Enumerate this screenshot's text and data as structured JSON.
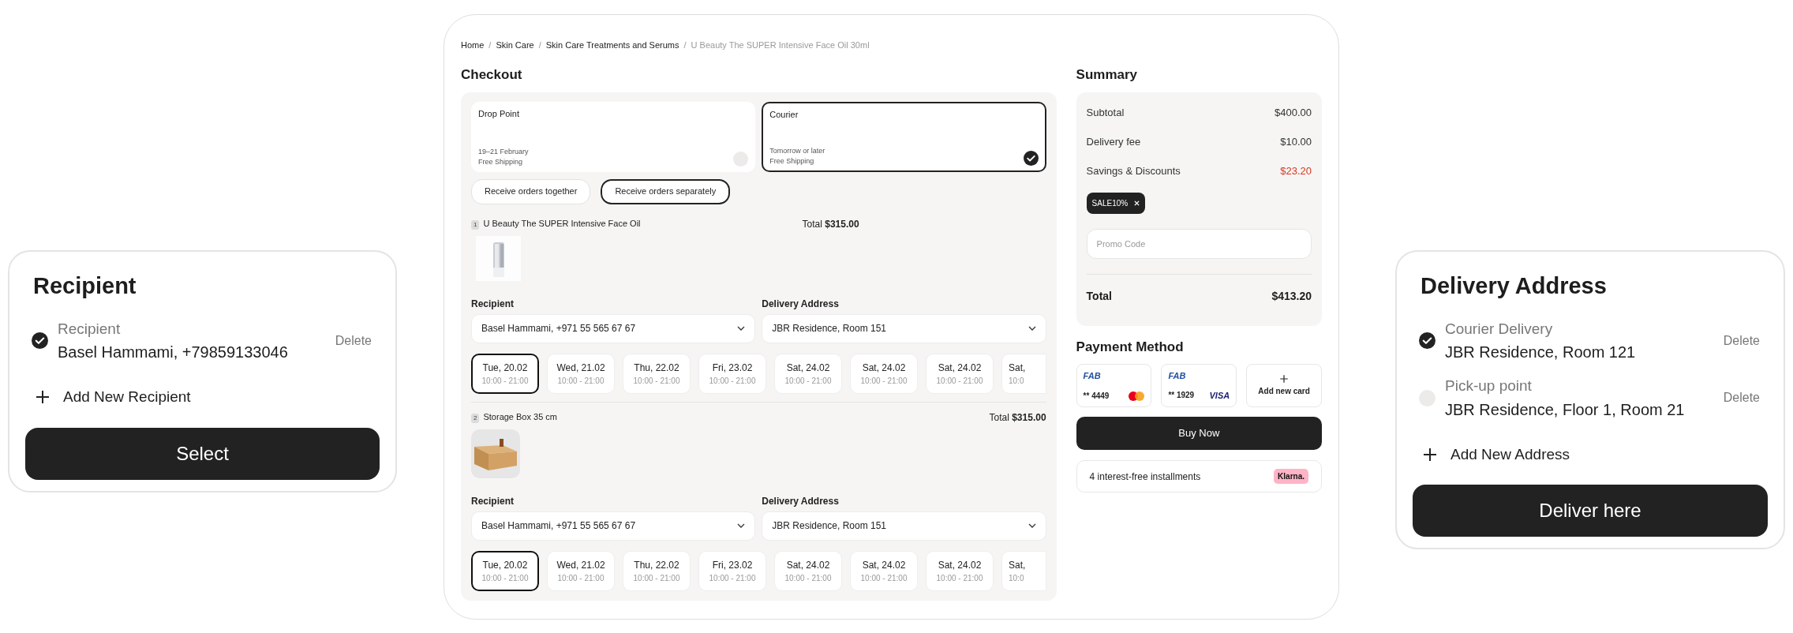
{
  "recipient_panel": {
    "title": "Recipient",
    "options": [
      {
        "label": "Recipient",
        "value": "Basel Hammami, +79859133046",
        "action": "Delete",
        "selected": true
      }
    ],
    "add_label": "Add New Recipient",
    "button": "Select"
  },
  "checkout": {
    "breadcrumb": [
      {
        "label": "Home",
        "current": false
      },
      {
        "label": "Skin Care",
        "current": false
      },
      {
        "label": "Skin Care Treatments and Serums",
        "current": false
      },
      {
        "label": "U Beauty The SUPER Intensive Face Oil 30ml",
        "current": true
      }
    ],
    "breadcrumb_separator": "/",
    "title": "Checkout",
    "delivery_methods": [
      {
        "name": "Drop Point",
        "date": "19–21 February",
        "note": "Free Shipping",
        "selected": false
      },
      {
        "name": "Courier",
        "date": "Tomorrow or later",
        "note": "Free Shipping",
        "selected": true
      }
    ],
    "grouping": [
      {
        "label": "Receive orders together",
        "selected": false
      },
      {
        "label": "Receive orders separately",
        "selected": true
      }
    ],
    "shipments": [
      {
        "index": "1",
        "name": "U Beauty The SUPER Intensive Face Oil",
        "total_label": "Total",
        "total": "$315.00",
        "recipient_label": "Recipient",
        "recipient": "Basel Hammami, +971 55 565 67 67",
        "address_label": "Delivery Address",
        "address": "JBR Residence, Room 151",
        "slots": [
          {
            "day": "Tue, 20.02",
            "time": "10:00 - 21:00",
            "selected": true
          },
          {
            "day": "Wed, 21.02",
            "time": "10:00 - 21:00",
            "selected": false
          },
          {
            "day": "Thu, 22.02",
            "time": "10:00 - 21:00",
            "selected": false
          },
          {
            "day": "Fri, 23.02",
            "time": "10:00 - 21:00",
            "selected": false
          },
          {
            "day": "Sat, 24.02",
            "time": "10:00 - 21:00",
            "selected": false
          },
          {
            "day": "Sat, 24.02",
            "time": "10:00 - 21:00",
            "selected": false
          },
          {
            "day": "Sat, 24.02",
            "time": "10:00 - 21:00",
            "selected": false
          },
          {
            "day": "Sat,",
            "time": "10:0",
            "selected": false
          }
        ]
      },
      {
        "index": "2",
        "name": "Storage Box 35 cm",
        "total_label": "Total",
        "total": "$315.00",
        "recipient_label": "Recipient",
        "recipient": "Basel Hammami, +971 55 565 67 67",
        "address_label": "Delivery Address",
        "address": "JBR Residence, Room 151",
        "slots": [
          {
            "day": "Tue, 20.02",
            "time": "10:00 - 21:00",
            "selected": true
          },
          {
            "day": "Wed, 21.02",
            "time": "10:00 - 21:00",
            "selected": false
          },
          {
            "day": "Thu, 22.02",
            "time": "10:00 - 21:00",
            "selected": false
          },
          {
            "day": "Fri, 23.02",
            "time": "10:00 - 21:00",
            "selected": false
          },
          {
            "day": "Sat, 24.02",
            "time": "10:00 - 21:00",
            "selected": false
          },
          {
            "day": "Sat, 24.02",
            "time": "10:00 - 21:00",
            "selected": false
          },
          {
            "day": "Sat, 24.02",
            "time": "10:00 - 21:00",
            "selected": false
          },
          {
            "day": "Sat,",
            "time": "10:0",
            "selected": false
          }
        ]
      }
    ]
  },
  "summary": {
    "title": "Summary",
    "rows": [
      {
        "label": "Subtotal",
        "value": "$400.00",
        "kind": "normal"
      },
      {
        "label": "Delivery fee",
        "value": "$10.00",
        "kind": "normal"
      },
      {
        "label": "Savings & Discounts",
        "value": "$23.20",
        "kind": "discount"
      }
    ],
    "promo_tag": "SALE10%",
    "promo_placeholder": "Promo Code",
    "total_label": "Total",
    "total": "$413.20"
  },
  "payment": {
    "title": "Payment Method",
    "cards": [
      {
        "kind": "mastercard",
        "bank": "FAB",
        "number": "** 4449"
      },
      {
        "kind": "visa",
        "bank": "FAB",
        "number": "** 1929",
        "network_label": "VISA"
      },
      {
        "kind": "add",
        "label": "Add new card"
      }
    ],
    "buy_button": "Buy Now",
    "installments": "4 interest-free installments",
    "installments_badge": "Klarna."
  },
  "address_panel": {
    "title": "Delivery Address",
    "options": [
      {
        "label": "Courier Delivery",
        "value": "JBR Residence, Room 121",
        "action": "Delete",
        "selected": true
      },
      {
        "label": "Pick-up point",
        "value": "JBR Residence, Floor 1, Room 21",
        "action": "Delete",
        "selected": false
      }
    ],
    "add_label": "Add New Address",
    "button": "Deliver here"
  }
}
